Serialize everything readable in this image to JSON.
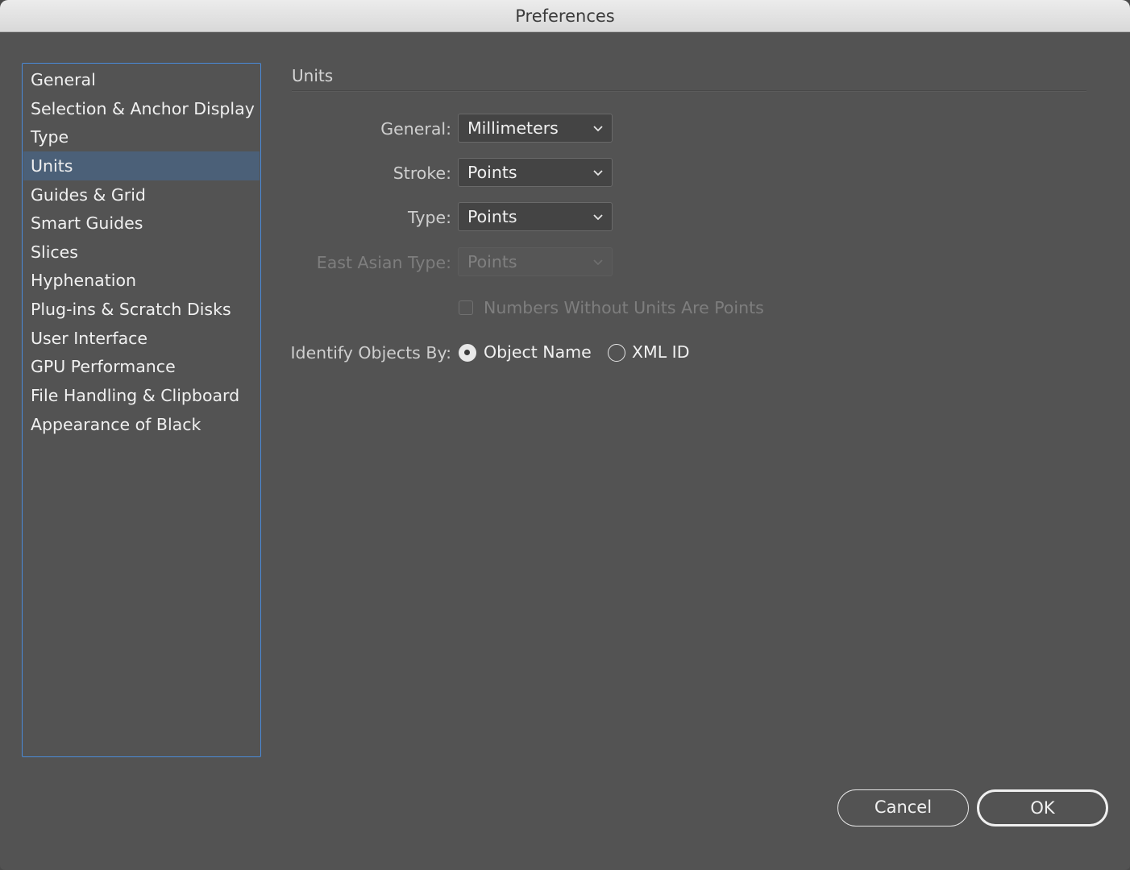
{
  "window": {
    "title": "Preferences"
  },
  "sidebar": {
    "items": [
      {
        "label": "General"
      },
      {
        "label": "Selection & Anchor Display"
      },
      {
        "label": "Type"
      },
      {
        "label": "Units",
        "selected": true
      },
      {
        "label": "Guides & Grid"
      },
      {
        "label": "Smart Guides"
      },
      {
        "label": "Slices"
      },
      {
        "label": "Hyphenation"
      },
      {
        "label": "Plug-ins & Scratch Disks"
      },
      {
        "label": "User Interface"
      },
      {
        "label": "GPU Performance"
      },
      {
        "label": "File Handling & Clipboard"
      },
      {
        "label": "Appearance of Black"
      }
    ]
  },
  "units": {
    "section_title": "Units",
    "general": {
      "label": "General:",
      "value": "Millimeters"
    },
    "stroke": {
      "label": "Stroke:",
      "value": "Points"
    },
    "type": {
      "label": "Type:",
      "value": "Points"
    },
    "east_asian_type": {
      "label": "East Asian Type:",
      "value": "Points",
      "disabled": true
    },
    "numbers_without_units": {
      "label": "Numbers Without Units Are Points",
      "checked": false,
      "disabled": true
    },
    "identify_objects": {
      "label": "Identify Objects By:",
      "options": [
        {
          "label": "Object Name",
          "checked": true
        },
        {
          "label": "XML ID",
          "checked": false
        }
      ]
    }
  },
  "buttons": {
    "cancel": "Cancel",
    "ok": "OK"
  },
  "colors": {
    "accent": "#4a8ad8",
    "selection": "#4b6078",
    "panel": "#535353"
  }
}
